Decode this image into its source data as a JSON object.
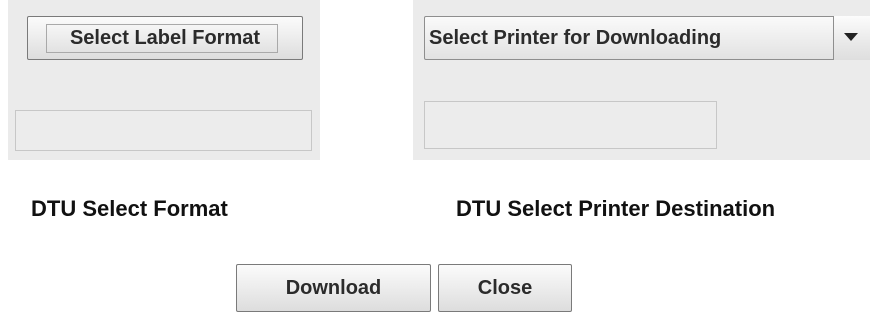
{
  "format_panel": {
    "select_button_label": "Select Label Format",
    "caption": "DTU Select Format",
    "field_value": ""
  },
  "printer_panel": {
    "selected_option": "Select Printer for Downloading",
    "dropdown_icon": "triangle-down-icon",
    "caption": "DTU Select Printer Destination",
    "field_value": ""
  },
  "actions": {
    "download_label": "Download",
    "close_label": "Close"
  },
  "colors": {
    "panel_background": "#ebebeb",
    "button_text": "#2b2b2b",
    "caption_text": "#111111",
    "border": "#7a7a7a"
  }
}
